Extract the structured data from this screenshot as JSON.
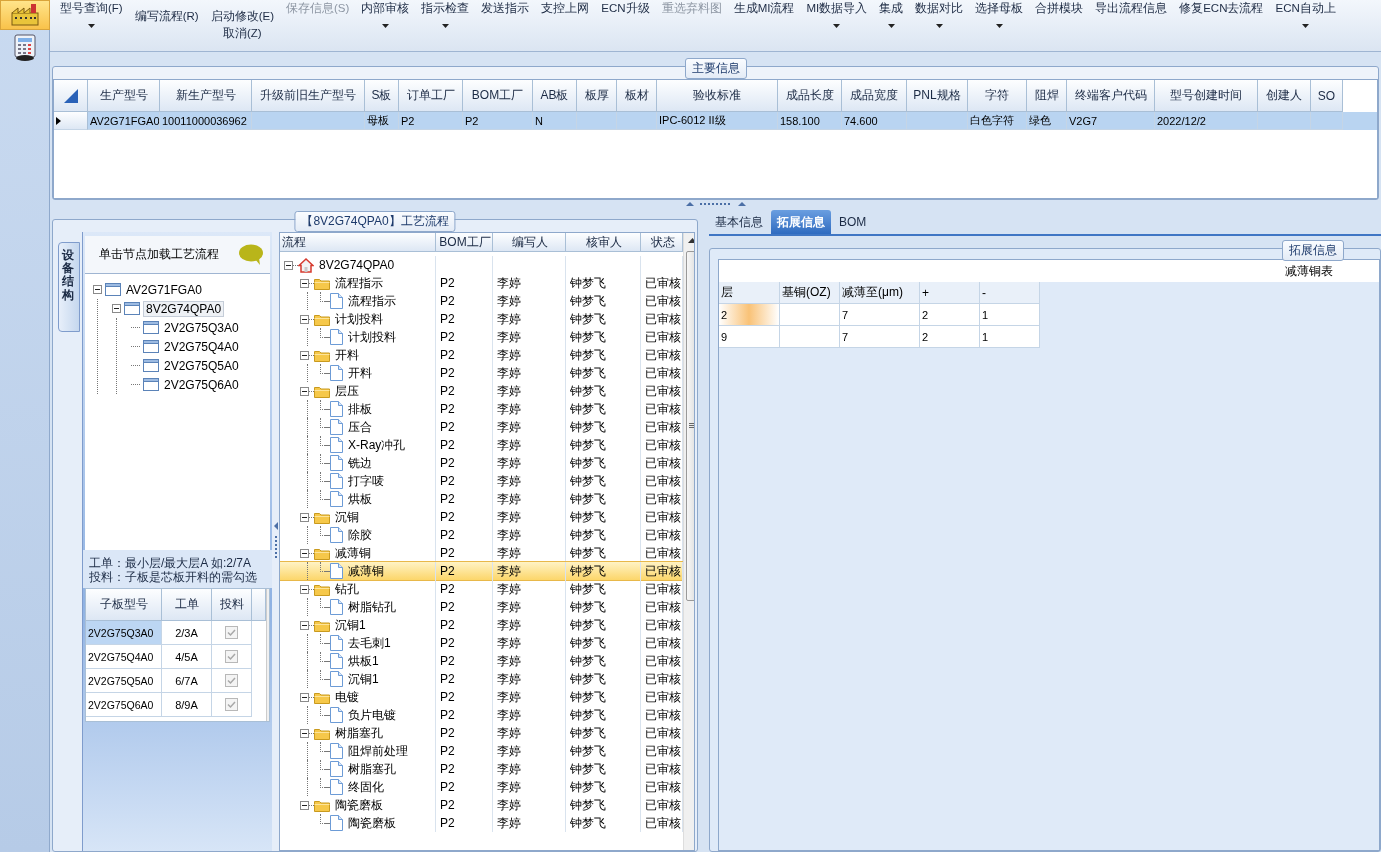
{
  "sidebar": [
    {
      "kind": "factory",
      "selected": true
    },
    {
      "kind": "calculator",
      "selected": false
    }
  ],
  "toolbar": [
    {
      "kind": "large",
      "label": "型号查询(F)",
      "dropdown": true,
      "disabled": false
    },
    {
      "kind": "stack",
      "items": [
        {
          "label": "编写流程(R)"
        }
      ]
    },
    {
      "kind": "stack",
      "items": [
        {
          "label": "启动修改(E)"
        },
        {
          "label": "取消(Z)"
        }
      ]
    },
    {
      "kind": "large",
      "label": "保存信息(S)",
      "dropdown": false,
      "disabled": true
    },
    {
      "kind": "large",
      "label": "内部审核",
      "dropdown": true,
      "disabled": false
    },
    {
      "kind": "large",
      "label": "指示检查",
      "dropdown": true,
      "disabled": false
    },
    {
      "kind": "large",
      "label": "发送指示",
      "dropdown": false,
      "disabled": false
    },
    {
      "kind": "large",
      "label": "支控上网",
      "dropdown": false,
      "disabled": false
    },
    {
      "kind": "large",
      "label": "ECN升级",
      "dropdown": false,
      "disabled": false
    },
    {
      "kind": "large",
      "label": "重选弃料图",
      "dropdown": false,
      "disabled": true
    },
    {
      "kind": "large",
      "label": "生成MI流程",
      "dropdown": false,
      "disabled": false
    },
    {
      "kind": "large",
      "label": "MI数据导入",
      "dropdown": true,
      "disabled": false
    },
    {
      "kind": "large",
      "label": "集成",
      "dropdown": true,
      "disabled": false
    },
    {
      "kind": "large",
      "label": "数据对比",
      "dropdown": true,
      "disabled": false
    },
    {
      "kind": "large",
      "label": "选择母板",
      "dropdown": true,
      "disabled": false
    },
    {
      "kind": "large",
      "label": "合拼模块",
      "dropdown": false,
      "disabled": false
    },
    {
      "kind": "large",
      "label": "导出流程信息",
      "dropdown": false,
      "disabled": false
    },
    {
      "kind": "large",
      "label": "修复ECN去流程",
      "dropdown": false,
      "disabled": false
    },
    {
      "kind": "large",
      "label": "ECN自动上",
      "dropdown": true,
      "disabled": false
    }
  ],
  "main_info": {
    "title": "主要信息",
    "columns": [
      "生产型号",
      "新生产型号",
      "升级前旧生产型号",
      "S板",
      "订单工厂",
      "BOM工厂",
      "AB板",
      "板厚",
      "板材",
      "验收标准",
      "成品长度",
      "成品宽度",
      "PNL规格",
      "字符",
      "阻焊",
      "终端客户代码",
      "型号创建时间",
      "创建人",
      "SO"
    ],
    "rows": [
      {
        "selected": true,
        "cells": [
          "AV2G71FGA0",
          "10011000036962",
          null,
          "母板",
          "P2",
          "P2",
          "N",
          null,
          null,
          "IPC-6012 II级",
          "158.100",
          "74.600",
          null,
          "白色字符",
          "绿色",
          "V2G7",
          "2022/12/2",
          null,
          null
        ]
      }
    ]
  },
  "process_panel": {
    "title": "【8V2G74QPA0】工艺流程",
    "side_tab": "设备结构",
    "header": "单击节点加载工艺流程",
    "device_tree": [
      {
        "label": "AV2G71FGA0",
        "selected": false,
        "expanded": true,
        "children": [
          {
            "label": "8V2G74QPA0",
            "selected": true,
            "expanded": true,
            "children": [
              {
                "label": "2V2G75Q3A0",
                "selected": false
              },
              {
                "label": "2V2G75Q4A0",
                "selected": false
              },
              {
                "label": "2V2G75Q5A0",
                "selected": false
              },
              {
                "label": "2V2G75Q6A0",
                "selected": false
              }
            ]
          }
        ]
      }
    ],
    "notes": [
      "工单：最小层/最大层A 如:2/7A",
      "投料：子板是芯板开料的需勾选"
    ],
    "sub_table": {
      "columns": [
        "子板型号",
        "工单",
        "投料"
      ],
      "rows": [
        {
          "model": "2V2G75Q3A0",
          "order": "2/3A",
          "feed": true,
          "selected": true
        },
        {
          "model": "2V2G75Q4A0",
          "order": "4/5A",
          "feed": true,
          "selected": false
        },
        {
          "model": "2V2G75Q5A0",
          "order": "6/7A",
          "feed": true,
          "selected": false
        },
        {
          "model": "2V2G75Q6A0",
          "order": "8/9A",
          "feed": true,
          "selected": false
        }
      ]
    },
    "flow": {
      "columns": [
        "流程",
        "BOM工厂",
        "编写人",
        "核审人",
        "状态"
      ],
      "tree": [
        {
          "kind": "root",
          "label": "8V2G74QPA0",
          "expanded": true,
          "selected": false,
          "children": [
            {
              "kind": "folder",
              "label": "流程指示",
              "bom": "P2",
              "writer": "李婷",
              "reviewer": "钟梦飞",
              "status": "已审核",
              "expanded": true,
              "selected": false,
              "children": [
                {
                  "kind": "doc",
                  "label": "流程指示",
                  "bom": "P2",
                  "writer": "李婷",
                  "reviewer": "钟梦飞",
                  "status": "已审核",
                  "selected": false
                }
              ]
            },
            {
              "kind": "folder",
              "label": "计划投料",
              "bom": "P2",
              "writer": "李婷",
              "reviewer": "钟梦飞",
              "status": "已审核",
              "expanded": true,
              "selected": false,
              "children": [
                {
                  "kind": "doc",
                  "label": "计划投料",
                  "bom": "P2",
                  "writer": "李婷",
                  "reviewer": "钟梦飞",
                  "status": "已审核",
                  "selected": false
                }
              ]
            },
            {
              "kind": "folder",
              "label": "开料",
              "bom": "P2",
              "writer": "李婷",
              "reviewer": "钟梦飞",
              "status": "已审核",
              "expanded": true,
              "selected": false,
              "children": [
                {
                  "kind": "doc",
                  "label": "开料",
                  "bom": "P2",
                  "writer": "李婷",
                  "reviewer": "钟梦飞",
                  "status": "已审核",
                  "selected": false
                }
              ]
            },
            {
              "kind": "folder",
              "label": "层压",
              "bom": "P2",
              "writer": "李婷",
              "reviewer": "钟梦飞",
              "status": "已审核",
              "expanded": true,
              "selected": false,
              "children": [
                {
                  "kind": "doc",
                  "label": "排板",
                  "bom": "P2",
                  "writer": "李婷",
                  "reviewer": "钟梦飞",
                  "status": "已审核",
                  "selected": false
                },
                {
                  "kind": "doc",
                  "label": "压合",
                  "bom": "P2",
                  "writer": "李婷",
                  "reviewer": "钟梦飞",
                  "status": "已审核",
                  "selected": false
                },
                {
                  "kind": "doc",
                  "label": "X-Ray冲孔",
                  "bom": "P2",
                  "writer": "李婷",
                  "reviewer": "钟梦飞",
                  "status": "已审核",
                  "selected": false
                },
                {
                  "kind": "doc",
                  "label": "铣边",
                  "bom": "P2",
                  "writer": "李婷",
                  "reviewer": "钟梦飞",
                  "status": "已审核",
                  "selected": false
                },
                {
                  "kind": "doc",
                  "label": "打字唛",
                  "bom": "P2",
                  "writer": "李婷",
                  "reviewer": "钟梦飞",
                  "status": "已审核",
                  "selected": false
                },
                {
                  "kind": "doc",
                  "label": "烘板",
                  "bom": "P2",
                  "writer": "李婷",
                  "reviewer": "钟梦飞",
                  "status": "已审核",
                  "selected": false
                }
              ]
            },
            {
              "kind": "folder",
              "label": "沉铜",
              "bom": "P2",
              "writer": "李婷",
              "reviewer": "钟梦飞",
              "status": "已审核",
              "expanded": true,
              "selected": false,
              "children": [
                {
                  "kind": "doc",
                  "label": "除胶",
                  "bom": "P2",
                  "writer": "李婷",
                  "reviewer": "钟梦飞",
                  "status": "已审核",
                  "selected": false
                }
              ]
            },
            {
              "kind": "folder",
              "label": "减薄铜",
              "bom": "P2",
              "writer": "李婷",
              "reviewer": "钟梦飞",
              "status": "已审核",
              "expanded": true,
              "selected": false,
              "children": [
                {
                  "kind": "doc",
                  "label": "减薄铜",
                  "bom": "P2",
                  "writer": "李婷",
                  "reviewer": "钟梦飞",
                  "status": "已审核",
                  "selected": true
                }
              ]
            },
            {
              "kind": "folder",
              "label": "钻孔",
              "bom": "P2",
              "writer": "李婷",
              "reviewer": "钟梦飞",
              "status": "已审核",
              "expanded": true,
              "selected": false,
              "children": [
                {
                  "kind": "doc",
                  "label": "树脂钻孔",
                  "bom": "P2",
                  "writer": "李婷",
                  "reviewer": "钟梦飞",
                  "status": "已审核",
                  "selected": false
                }
              ]
            },
            {
              "kind": "folder",
              "label": "沉铜1",
              "bom": "P2",
              "writer": "李婷",
              "reviewer": "钟梦飞",
              "status": "已审核",
              "expanded": true,
              "selected": false,
              "children": [
                {
                  "kind": "doc",
                  "label": "去毛刺1",
                  "bom": "P2",
                  "writer": "李婷",
                  "reviewer": "钟梦飞",
                  "status": "已审核",
                  "selected": false
                },
                {
                  "kind": "doc",
                  "label": "烘板1",
                  "bom": "P2",
                  "writer": "李婷",
                  "reviewer": "钟梦飞",
                  "status": "已审核",
                  "selected": false
                },
                {
                  "kind": "doc",
                  "label": "沉铜1",
                  "bom": "P2",
                  "writer": "李婷",
                  "reviewer": "钟梦飞",
                  "status": "已审核",
                  "selected": false
                }
              ]
            },
            {
              "kind": "folder",
              "label": "电镀",
              "bom": "P2",
              "writer": "李婷",
              "reviewer": "钟梦飞",
              "status": "已审核",
              "expanded": true,
              "selected": false,
              "children": [
                {
                  "kind": "doc",
                  "label": "负片电镀",
                  "bom": "P2",
                  "writer": "李婷",
                  "reviewer": "钟梦飞",
                  "status": "已审核",
                  "selected": false
                }
              ]
            },
            {
              "kind": "folder",
              "label": "树脂塞孔",
              "bom": "P2",
              "writer": "李婷",
              "reviewer": "钟梦飞",
              "status": "已审核",
              "expanded": true,
              "selected": false,
              "children": [
                {
                  "kind": "doc",
                  "label": "阻焊前处理",
                  "bom": "P2",
                  "writer": "李婷",
                  "reviewer": "钟梦飞",
                  "status": "已审核",
                  "selected": false
                },
                {
                  "kind": "doc",
                  "label": "树脂塞孔",
                  "bom": "P2",
                  "writer": "李婷",
                  "reviewer": "钟梦飞",
                  "status": "已审核",
                  "selected": false
                },
                {
                  "kind": "doc",
                  "label": "终固化",
                  "bom": "P2",
                  "writer": "李婷",
                  "reviewer": "钟梦飞",
                  "status": "已审核",
                  "selected": false
                }
              ]
            },
            {
              "kind": "folder",
              "label": "陶瓷磨板",
              "bom": "P2",
              "writer": "李婷",
              "reviewer": "钟梦飞",
              "status": "已审核",
              "expanded": true,
              "selected": false,
              "children": [
                {
                  "kind": "doc",
                  "label": "陶瓷磨板",
                  "bom": "P2",
                  "writer": "李婷",
                  "reviewer": "钟梦飞",
                  "status": "已审核",
                  "selected": false
                }
              ]
            }
          ]
        }
      ]
    }
  },
  "detail_panel": {
    "tabs": [
      {
        "label": "基本信息",
        "selected": false
      },
      {
        "label": "拓展信息",
        "selected": true
      },
      {
        "label": "BOM",
        "selected": false
      }
    ],
    "group_title": "拓展信息",
    "table_title": "减薄铜表",
    "columns": [
      "层",
      "基铜(OZ)",
      "减薄至(μm)",
      "+",
      "-"
    ],
    "rows": [
      {
        "layer": "2",
        "thin_to": "7",
        "plus": "2",
        "minus": "1",
        "selected": true
      },
      {
        "layer": "9",
        "thin_to": "7",
        "plus": "2",
        "minus": "1",
        "selected": false
      }
    ]
  }
}
